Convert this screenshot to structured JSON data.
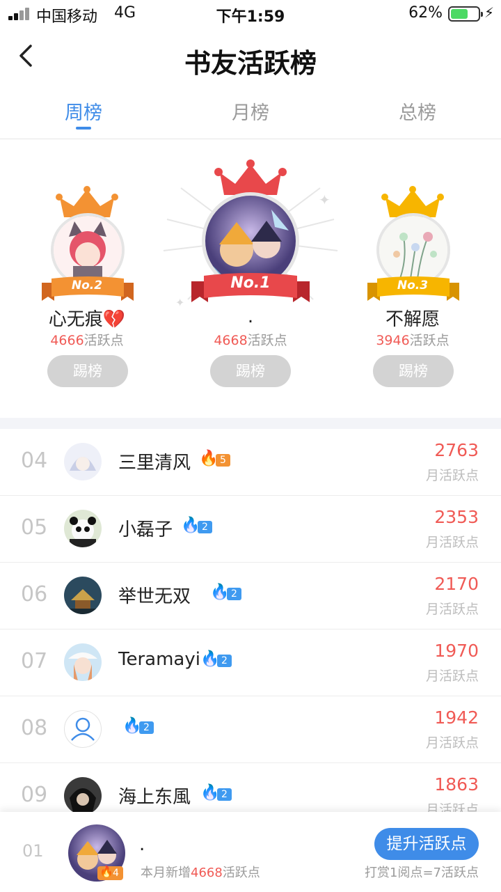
{
  "status_bar": {
    "carrier": "中国移动",
    "network": "4G",
    "time": "下午1:59",
    "battery_percent": "62%",
    "battery_level": 0.62
  },
  "nav": {
    "title": "书友活跃榜"
  },
  "tabs": [
    {
      "label": "周榜",
      "active": true
    },
    {
      "label": "月榜",
      "active": false
    },
    {
      "label": "总榜",
      "active": false
    }
  ],
  "podium": {
    "first": {
      "rank_label": "No.1",
      "name": ".",
      "score": "4668",
      "unit": "活跃点",
      "button": "踢榜"
    },
    "second": {
      "rank_label": "No.2",
      "name": "心无痕💔",
      "score": "4666",
      "unit": "活跃点",
      "button": "踢榜"
    },
    "third": {
      "rank_label": "No.3",
      "name": "不解愿",
      "score": "3946",
      "unit": "活跃点",
      "button": "踢榜"
    }
  },
  "list": [
    {
      "rank": "04",
      "name": "三里清风",
      "level": "5",
      "level_color": "#f39233",
      "score": "2763",
      "unit": "月活跃点",
      "avatar": "avatar-white-hair"
    },
    {
      "rank": "05",
      "name": "小磊子",
      "level": "2",
      "level_color": "#3f9af0",
      "score": "2353",
      "unit": "月活跃点",
      "avatar": "avatar-panda"
    },
    {
      "rank": "06",
      "name": " 举世无双",
      "level": "2",
      "level_color": "#3f9af0",
      "score": "2170",
      "unit": "月活跃点",
      "avatar": "avatar-temple"
    },
    {
      "rank": "07",
      "name": "Teramayi",
      "level": "2",
      "level_color": "#3f9af0",
      "score": "1970",
      "unit": "月活跃点",
      "avatar": "avatar-anime-girl"
    },
    {
      "rank": "08",
      "name": "",
      "level": "2",
      "level_color": "#3f9af0",
      "score": "1942",
      "unit": "月活跃点",
      "avatar": "avatar-default-user"
    },
    {
      "rank": "09",
      "name": "海上东風",
      "level": "2",
      "level_color": "#3f9af0",
      "score": "1863",
      "unit": "月活跃点",
      "avatar": "avatar-dark-hair"
    }
  ],
  "my_rank": {
    "rank": "01",
    "name": ".",
    "level": "4",
    "sub_prefix": "本月新增",
    "sub_value": "4668",
    "sub_suffix": "活跃点",
    "button": "提升活跃点",
    "note": "打赏1阅点=7活跃点"
  },
  "colors": {
    "accent": "#3f8ce8",
    "score_red": "#f05a55",
    "gold": "#f7b500",
    "orange": "#f39233",
    "crimson": "#e8484b"
  }
}
